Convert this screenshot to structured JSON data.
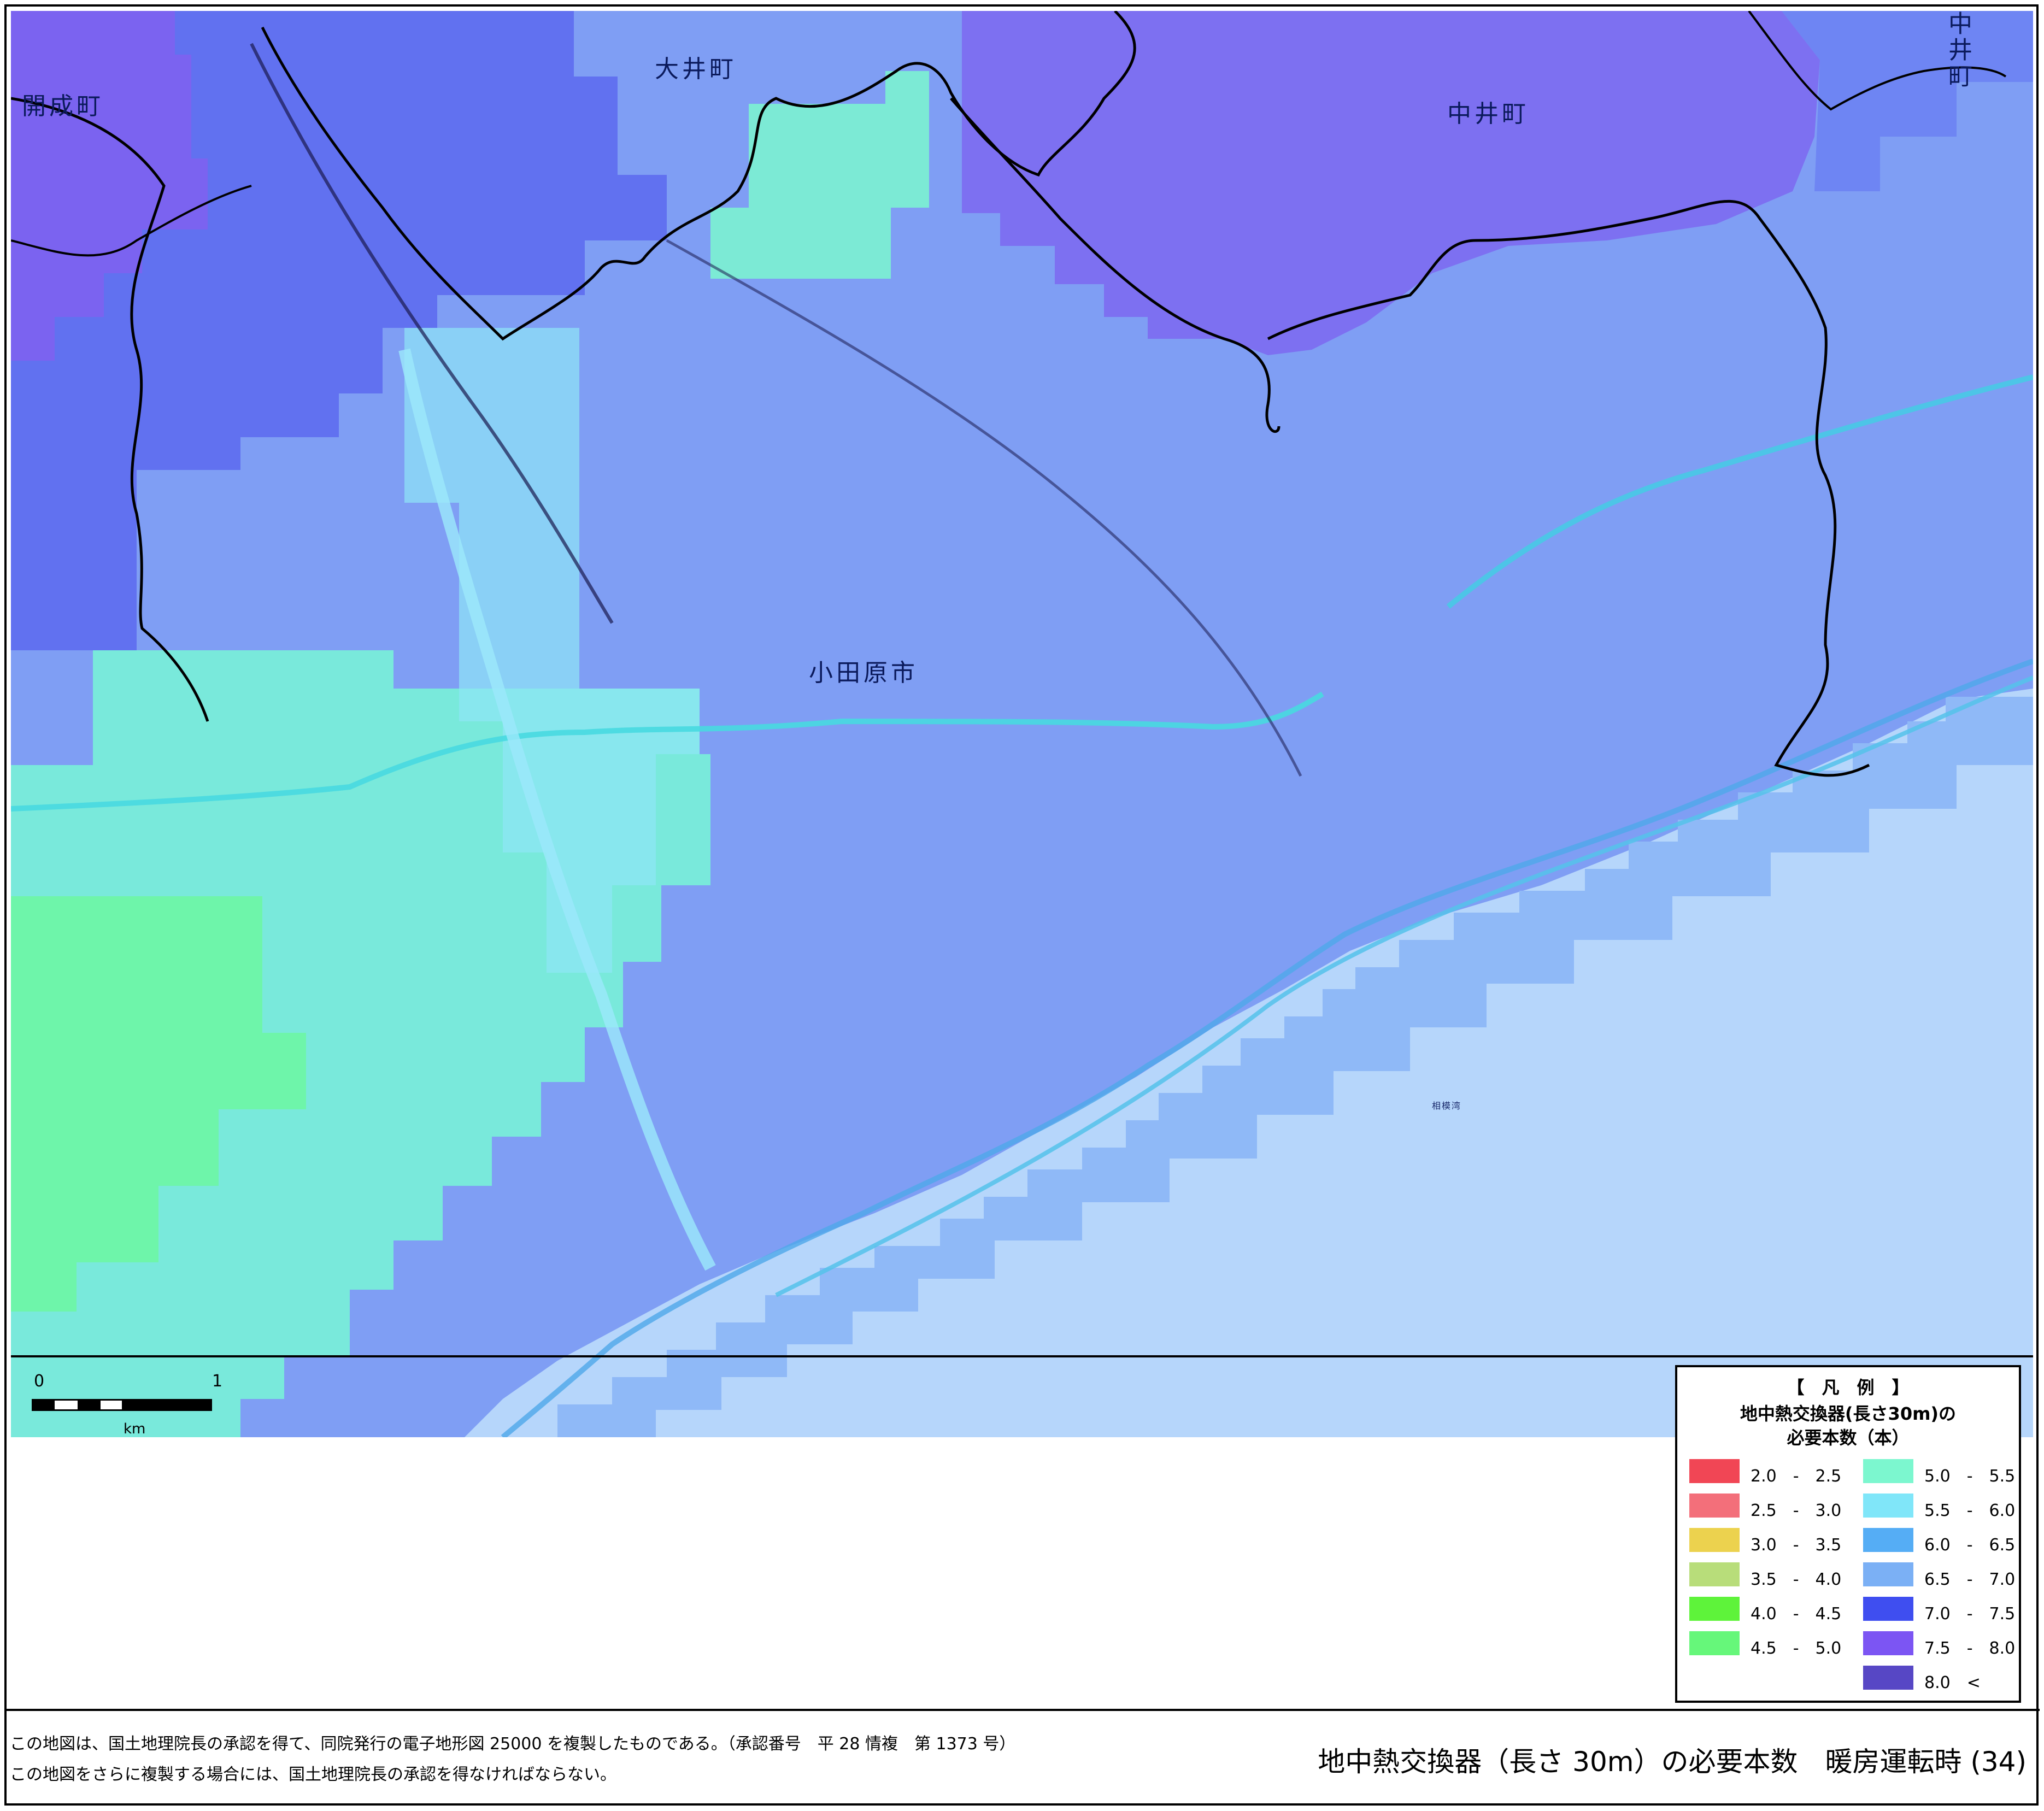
{
  "map": {
    "places": {
      "kaisei": "開成町",
      "oi": "大井町",
      "nakai": "中井町",
      "nakai_edge": "中井町",
      "odawara": "小田原市",
      "sea": "相模湾"
    },
    "scale_bar": {
      "start": "0",
      "end": "1",
      "unit": "km"
    }
  },
  "legend": {
    "heading": "【　凡　例　】",
    "title_line1": "地中熱交換器(長さ30m)の",
    "title_line2": "必要本数（本）",
    "items": [
      {
        "label": "2.0　-　2.5",
        "color": "#f14655"
      },
      {
        "label": "2.5　-　3.0",
        "color": "#f36f7a"
      },
      {
        "label": "3.0　-　3.5",
        "color": "#ecd24e"
      },
      {
        "label": "3.5　-　4.0",
        "color": "#b8dd7a"
      },
      {
        "label": "4.0　-　4.5",
        "color": "#5ef33a"
      },
      {
        "label": "4.5　-　5.0",
        "color": "#66f77a"
      },
      {
        "label": "5.0　-　5.5",
        "color": "#7cf7cf"
      },
      {
        "label": "5.5　-　6.0",
        "color": "#80e6f9"
      },
      {
        "label": "6.0　-　6.5",
        "color": "#55adf5"
      },
      {
        "label": "6.5　-　7.0",
        "color": "#7bb0f5"
      },
      {
        "label": "7.0　-　7.5",
        "color": "#3f4ef0"
      },
      {
        "label": "7.5　-　8.0",
        "color": "#7c55f3"
      },
      {
        "label": "8.0　<",
        "color": "#5747c5"
      }
    ]
  },
  "footer": {
    "note_line1": "この地図は、国土地理院長の承認を得て、同院発行の電子地形図 25000 を複製したものである。（承認番号　平 28 情複　第 1373 号）",
    "note_line2": "この地図をさらに複製する場合には、国土地理院長の承認を得なければならない。",
    "title": "地中熱交換器（長さ 30m）の必要本数　暖房運転時 (34)"
  }
}
